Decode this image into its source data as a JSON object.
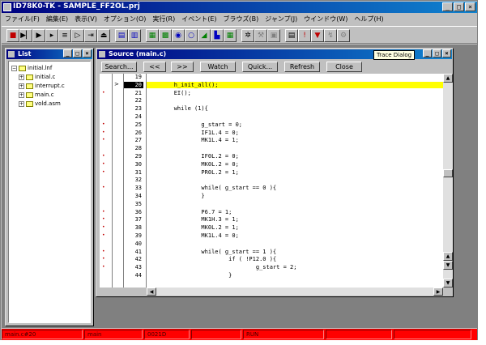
{
  "app": {
    "title": "ID78K0-TK - SAMPLE_FF2OL.prj"
  },
  "menu": [
    "ファイル(F)",
    "編集(E)",
    "表示(V)",
    "オプション(O)",
    "実行(R)",
    "イベント(E)",
    "ブラウズ(B)",
    "ジャンプ(J)",
    "ウインドウ(W)",
    "ヘルプ(H)"
  ],
  "tooltip": "Trace Dialog",
  "list_window": {
    "title": "List",
    "tree": [
      "initial.lnf",
      "initial.c",
      "interrupt.c",
      "main.c",
      "vold.asm"
    ]
  },
  "source_window": {
    "title": "Source (main.c)",
    "buttons": [
      "Search...",
      "<<",
      ">>",
      "Watch",
      "Quick...",
      "Refresh",
      "Close"
    ],
    "current_line": "20",
    "lines": [
      {
        "n": "19",
        "code": "",
        "bp": false
      },
      {
        "n": "20",
        "code": "        h_init_all();",
        "bp": false
      },
      {
        "n": "21",
        "code": "        EI();",
        "bp": true
      },
      {
        "n": "22",
        "code": "",
        "bp": false
      },
      {
        "n": "23",
        "code": "        while (1){",
        "bp": false
      },
      {
        "n": "24",
        "code": "",
        "bp": false
      },
      {
        "n": "25",
        "code": "                g_start = 0;",
        "bp": true
      },
      {
        "n": "26",
        "code": "                IF1L.4 = 0;",
        "bp": true
      },
      {
        "n": "27",
        "code": "                MK1L.4 = 1;",
        "bp": true
      },
      {
        "n": "28",
        "code": "",
        "bp": false
      },
      {
        "n": "29",
        "code": "                IF0L.2 = 0;",
        "bp": true
      },
      {
        "n": "30",
        "code": "                MK0L.2 = 0;",
        "bp": true
      },
      {
        "n": "31",
        "code": "                PR0L.2 = 1;",
        "bp": true
      },
      {
        "n": "32",
        "code": "",
        "bp": false
      },
      {
        "n": "33",
        "code": "                while( g_start == 0 ){",
        "bp": true
      },
      {
        "n": "34",
        "code": "                }",
        "bp": false
      },
      {
        "n": "35",
        "code": "",
        "bp": false
      },
      {
        "n": "36",
        "code": "                P6.7 = 1;",
        "bp": true
      },
      {
        "n": "37",
        "code": "                MK1H.3 = 1;",
        "bp": true
      },
      {
        "n": "38",
        "code": "                MK0L.2 = 1;",
        "bp": true
      },
      {
        "n": "39",
        "code": "                MK1L.4 = 0;",
        "bp": true
      },
      {
        "n": "40",
        "code": "",
        "bp": false
      },
      {
        "n": "41",
        "code": "                while( g_start == 1 ){",
        "bp": true
      },
      {
        "n": "42",
        "code": "                        if ( !P12.0 ){",
        "bp": true
      },
      {
        "n": "43",
        "code": "                                g_start = 2;",
        "bp": true
      },
      {
        "n": "44",
        "code": "                        }",
        "bp": false
      }
    ]
  },
  "status": [
    "main.c#20",
    "main",
    "0021D",
    "",
    "RUN",
    "",
    ""
  ]
}
